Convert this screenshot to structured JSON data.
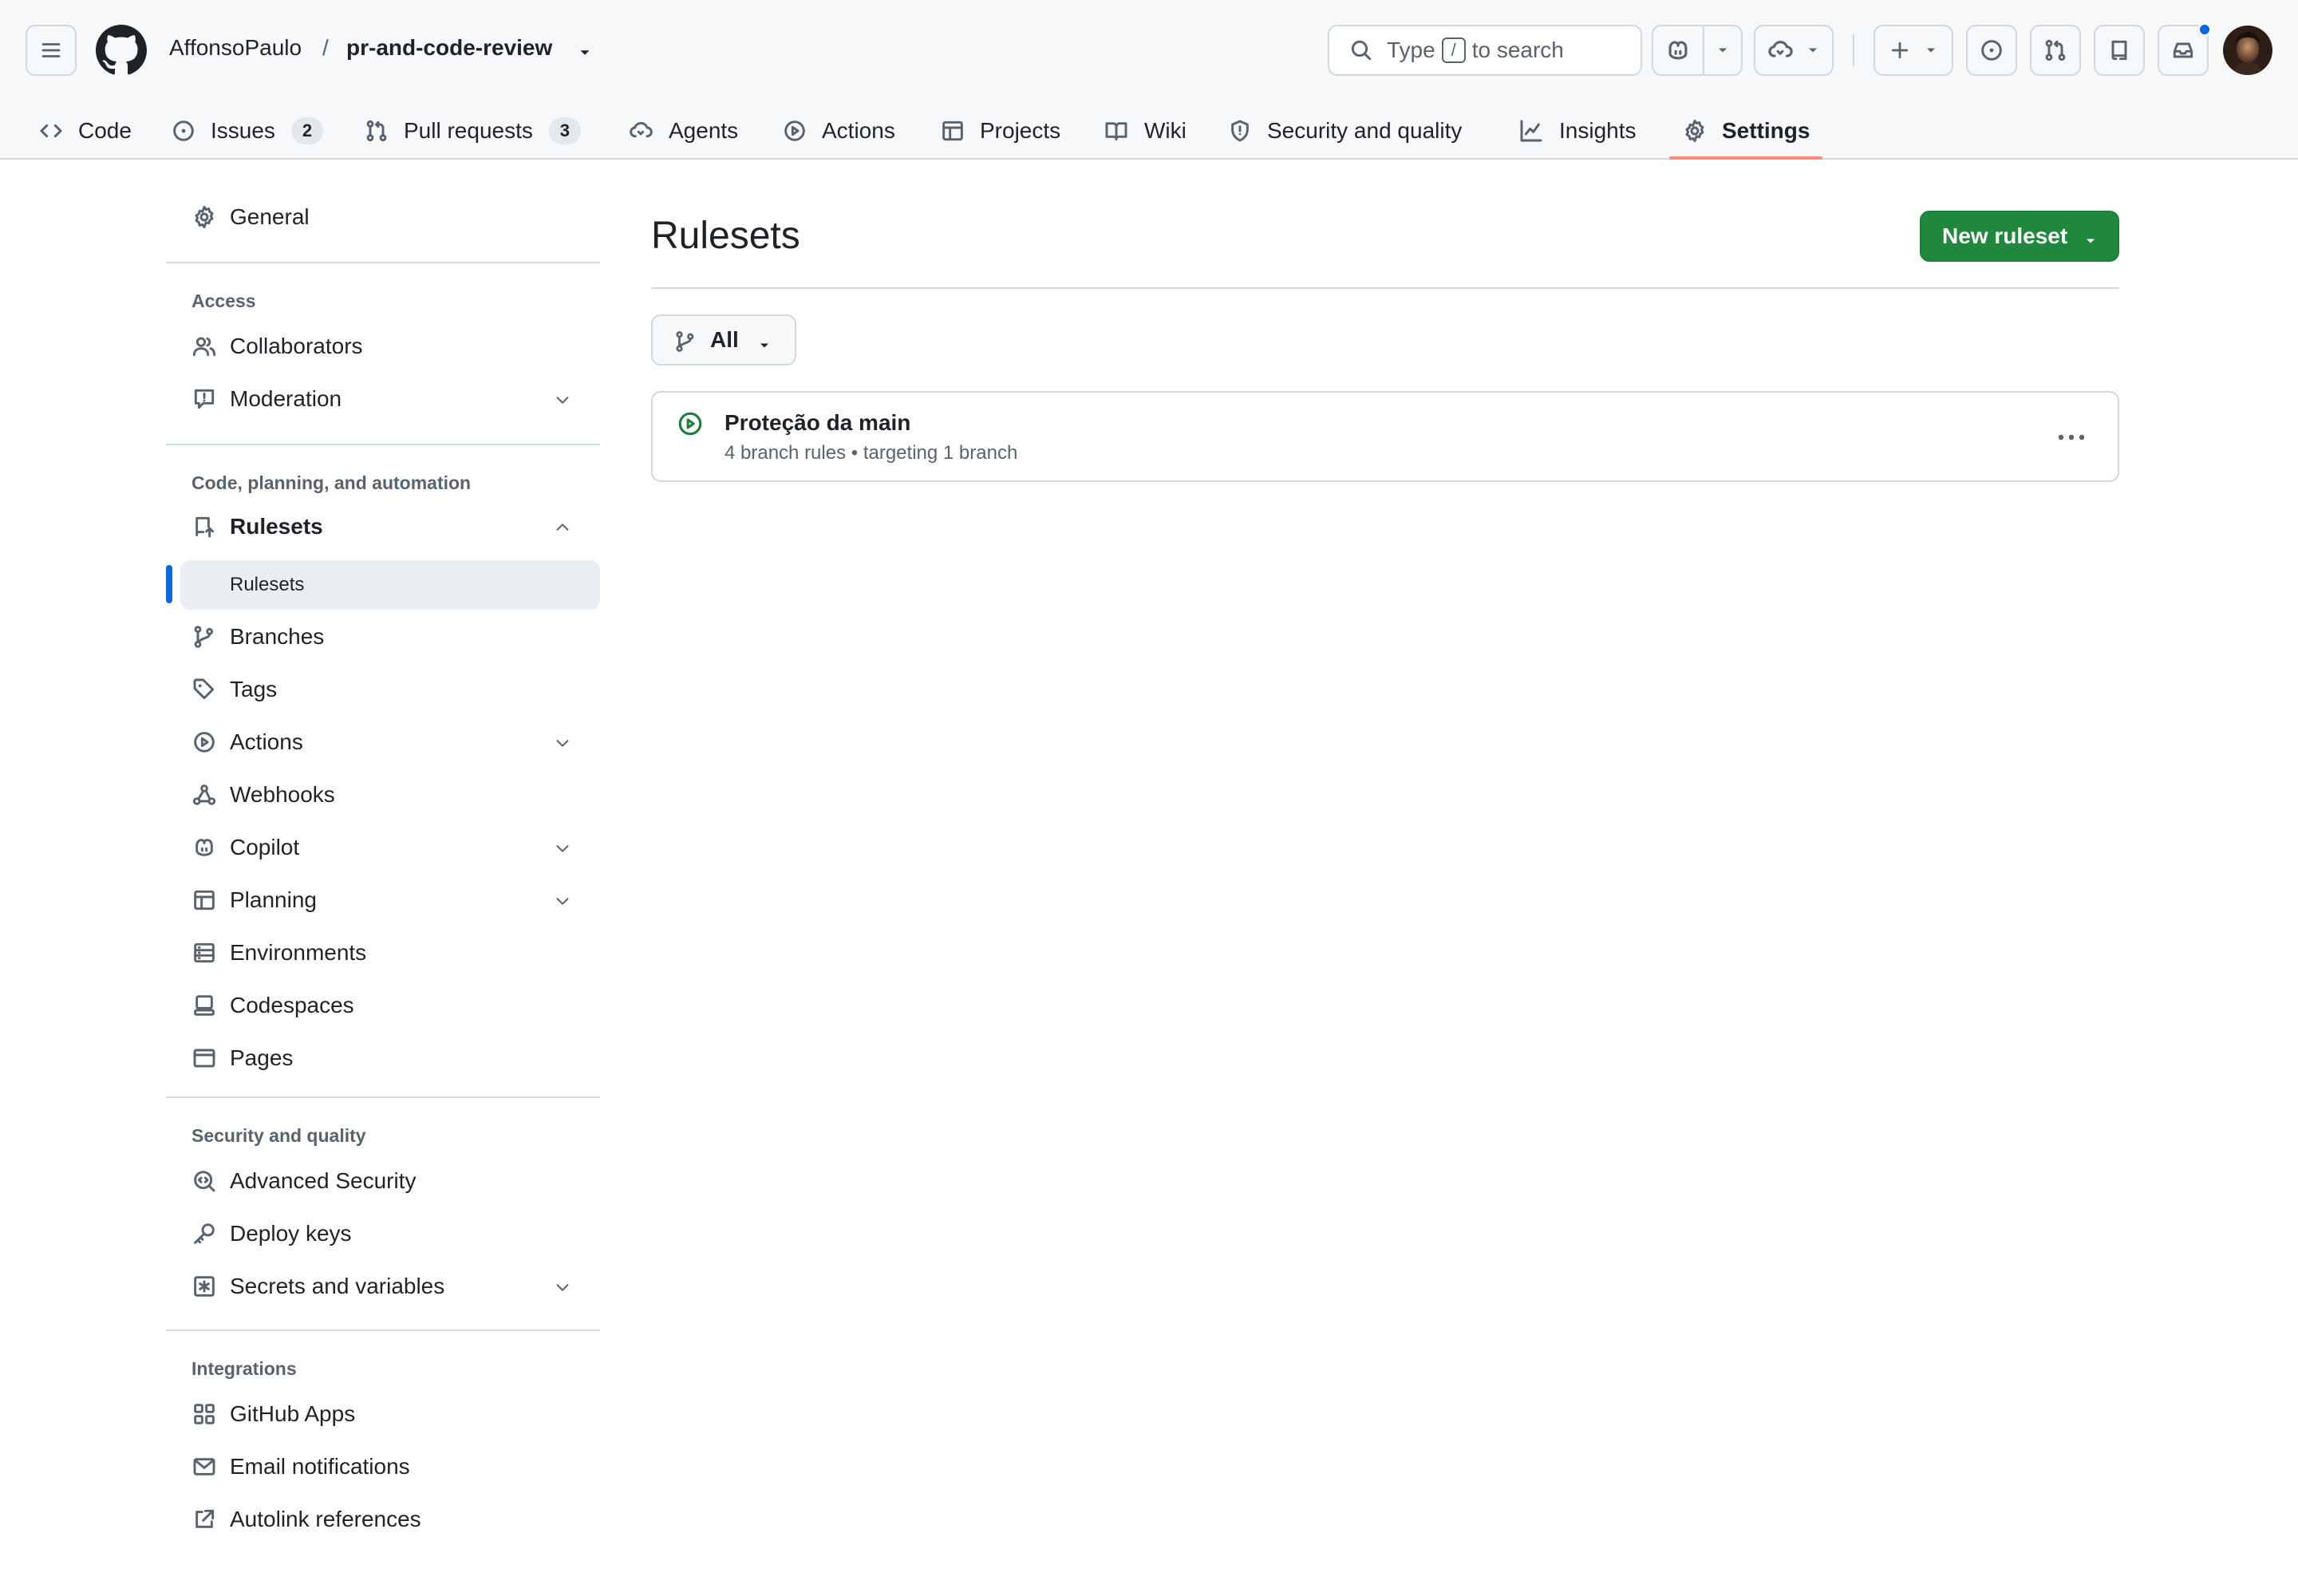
{
  "header": {
    "owner": "AffonsoPaulo",
    "separator": "/",
    "repo": "pr-and-code-review",
    "search": {
      "prefix": "Type",
      "key": "/",
      "suffix": "to search"
    }
  },
  "repo_nav": {
    "tabs": [
      {
        "label": "Code",
        "icon": "code-icon"
      },
      {
        "label": "Issues",
        "icon": "issue-opened-icon",
        "count": "2"
      },
      {
        "label": "Pull requests",
        "icon": "git-pull-request-icon",
        "count": "3"
      },
      {
        "label": "Agents",
        "icon": "agent-icon"
      },
      {
        "label": "Actions",
        "icon": "play-icon"
      },
      {
        "label": "Projects",
        "icon": "table-icon"
      },
      {
        "label": "Wiki",
        "icon": "book-icon"
      },
      {
        "label": "Security and quality",
        "icon": "shield-icon"
      },
      {
        "label": "Insights",
        "icon": "graph-icon"
      },
      {
        "label": "Settings",
        "icon": "gear-icon",
        "selected": true
      }
    ],
    "accent": "#fd8c73"
  },
  "sidebar": {
    "general": "General",
    "sections": {
      "access": "Access",
      "code": "Code, planning, and automation",
      "security": "Security and quality",
      "integrations": "Integrations"
    },
    "items": {
      "collaborators": "Collaborators",
      "moderation": "Moderation",
      "rulesets": "Rulesets",
      "rulesets_sub": "Rulesets",
      "branches": "Branches",
      "tags": "Tags",
      "actions": "Actions",
      "webhooks": "Webhooks",
      "copilot": "Copilot",
      "planning": "Planning",
      "environments": "Environments",
      "codespaces": "Codespaces",
      "pages": "Pages",
      "advanced_security": "Advanced Security",
      "deploy_keys": "Deploy keys",
      "secrets": "Secrets and variables",
      "github_apps": "GitHub Apps",
      "email_notifications": "Email notifications",
      "autolink": "Autolink references"
    },
    "active_color": "#0969da"
  },
  "main": {
    "title": "Rulesets",
    "new_button": "New ruleset",
    "filter": "All",
    "rulesets": [
      {
        "name": "Proteção da main",
        "meta": "4 branch rules • targeting 1 branch",
        "status": "active"
      }
    ],
    "primary_color": "#1f883d"
  }
}
